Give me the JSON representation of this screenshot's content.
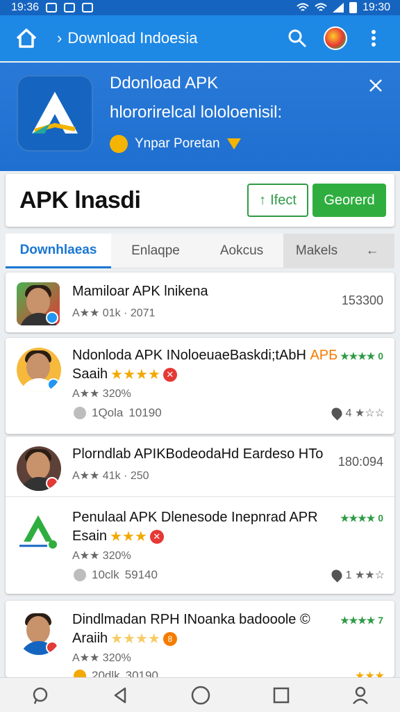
{
  "status_bar": {
    "time_left": "19:36",
    "time_right": "19:30"
  },
  "app_bar": {
    "breadcrumb_sep": "›",
    "breadcrumb": "Download Indoesia"
  },
  "banner": {
    "title": "Ddonload APK",
    "subtitle": "hlororirelcal lololoenisil:",
    "meta": "Ynpar Poretan"
  },
  "page": {
    "title": "APK lnasdi",
    "btn_outline_icon": "↑",
    "btn_outline": "Ifect",
    "btn_primary": "Georerd"
  },
  "tabs": [
    "Downhlaeas",
    "Enlaqpe",
    "Aokcus",
    "Makels",
    "←"
  ],
  "items": [
    {
      "title": "Mamiloar APK lnikena",
      "meta": "A★★ 01k · 2071",
      "right": "153300"
    },
    {
      "title": "Ndonloda APK INoloeuaeBaskdi;tAbH",
      "title_accent": "ΑΡБ",
      "right_stars": "★★★★ 0",
      "sub": "Saaih",
      "sub_stars": "★★★★",
      "meta": "A★★ 320%",
      "meta2a": "1Qola",
      "meta2b": "10190",
      "right_bottom": "4 ★☆☆"
    },
    {
      "title": "Plorndlab APIKBodeodaHd Eardeso HTo",
      "meta": "A★★ 41k · 250",
      "right": "180:094"
    },
    {
      "title": "Penulaal APK Dlenesode Inepnrad APR",
      "right_stars": "★★★★ 0",
      "sub": "Esain",
      "sub_stars": "★★★",
      "meta": "A★★ 320%",
      "meta2a": "10clk",
      "meta2b": "59140",
      "right_bottom": "1 ★★☆"
    },
    {
      "title": "Dindlmadan RPH INoanka badooole ©",
      "right_stars": "★★★★ 7",
      "sub": "Araiih",
      "sub_stars": "★★★★",
      "meta": "A★★ 320%",
      "meta2a": "20dlk",
      "meta2b": "30190",
      "right_bottom": "★★★"
    }
  ],
  "colors": {
    "primary": "#1e88e5",
    "accent_green": "#2fae3f",
    "star_gold": "#f2a900"
  }
}
